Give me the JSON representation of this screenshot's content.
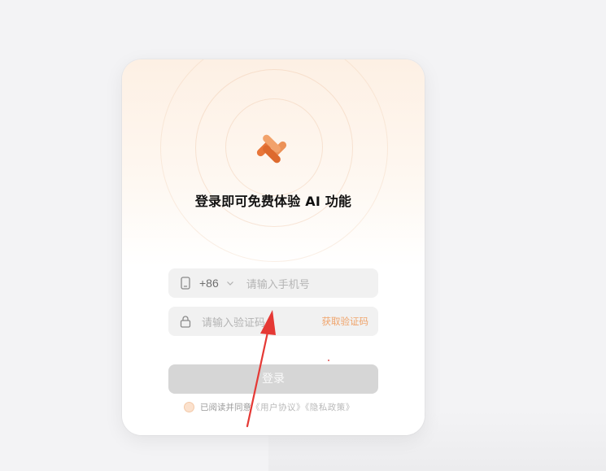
{
  "dialog": {
    "title": "登录即可免费体验 AI 功能"
  },
  "phone_field": {
    "country_code": "+86",
    "placeholder": "请输入手机号"
  },
  "code_field": {
    "placeholder": "请输入验证码",
    "get_code_label": "获取验证码"
  },
  "login_button": {
    "label": "登录"
  },
  "agreement": {
    "prefix": "已阅读并同意",
    "terms_text": "《用户协议》《隐私政策》"
  },
  "colors": {
    "accent": "#f0a46b",
    "logo": "#e8763a",
    "annotation_arrow": "#e53935"
  },
  "icons": {
    "phone": "phone-icon",
    "lock": "lock-icon",
    "chevron": "chevron-down-icon",
    "logo": "app-logo-icon"
  }
}
